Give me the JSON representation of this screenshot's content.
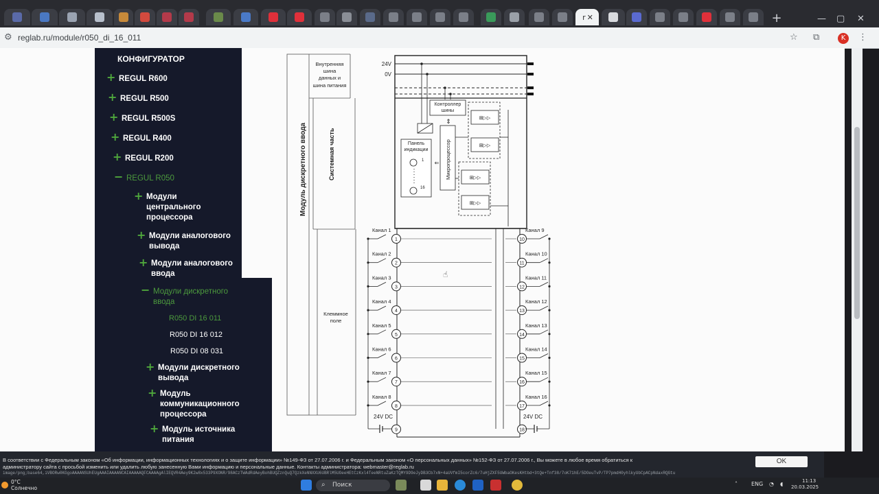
{
  "browser": {
    "active_tab_title": "r",
    "url": "reglab.ru/module/r050_di_16_011",
    "avatar_letter": "K"
  },
  "sidebar": {
    "title": "КОНФИГУРАТОР",
    "items": [
      {
        "label": "REGUL R600"
      },
      {
        "label": "REGUL R500"
      },
      {
        "label": "REGUL R500S"
      },
      {
        "label": "REGUL R400"
      },
      {
        "label": "REGUL R200"
      },
      {
        "label": "REGUL R050",
        "expanded": true
      }
    ],
    "sub_items": [
      {
        "label": "Модули центрального процессора"
      },
      {
        "label": "Модули аналогового вывода"
      },
      {
        "label": "Модули аналогового ввода"
      },
      {
        "label": "Модули дискретного ввода",
        "expanded": true
      },
      {
        "label": "Модули дискретного вывода"
      },
      {
        "label": "Модуль коммуникационного процессора"
      },
      {
        "label": "Модуль источника питания"
      }
    ],
    "modules": [
      {
        "label": "R050 DI 16 011",
        "selected": true
      },
      {
        "label": "R050 DI 16 012"
      },
      {
        "label": "R050 DI 08 031"
      }
    ]
  },
  "diagram": {
    "side_title": "Модуль дискретного ввода",
    "system_part": "Системная часть",
    "internal_bus": [
      "Внутренняя",
      "шина",
      "данных и",
      "шина питания"
    ],
    "terminal_field": [
      "Клеммное",
      "поле"
    ],
    "bus_24v": "24V",
    "bus_0v": "0V",
    "bus_controller": [
      "Контроллер",
      "шины"
    ],
    "indication_panel": [
      "Панель",
      "индикации"
    ],
    "microprocessor": "Микропроцессор",
    "channels_left": [
      "Канал 1",
      "Канал 2",
      "Канал 3",
      "Канал 4",
      "Канал 5",
      "Канал 6",
      "Канал 7",
      "Канал 8"
    ],
    "channels_right": [
      "Канал 9",
      "Канал 10",
      "Канал 11",
      "Канал 12",
      "Канал 13",
      "Канал 14",
      "Канал 15",
      "Канал 16"
    ],
    "terminals_left": [
      "1",
      "2",
      "3",
      "4",
      "5",
      "6",
      "7",
      "8",
      "9"
    ],
    "terminals_right": [
      "10",
      "11",
      "12",
      "13",
      "14",
      "15",
      "16",
      "17",
      "18"
    ],
    "supply_label": "24V DC",
    "led_first": "1",
    "led_last": "16"
  },
  "cookie": {
    "line1": "В соответствии с Федеральным законом «Об информации, информационных технологиях и о защите информации» №149-ФЗ от 27.07.2006 г. и Федеральным законом «О персональных данных» №152-ФЗ от 27.07.2006 г., Вы можете в любое время обратиться к",
    "line2": "администратору сайта с просьбой изменить или удалить любую занесенную Вами информацию и персональные данные. Контакты администратора: webmaster@reglab.ru",
    "line3": "image/png;base64,iVBORw0KGgoAAAANSUhEUgAAAIAAAANCAIAAAAAQFCAAAAgAlIEQVR4Aey9K2w8x533P9XONR/98ACzTWAdRdAeyBohBUQZznQuQ7QzkXeNNXXU6UBRlM5UOeeHEtCzKxl4TeeNRtuZaKzTQMY9D9eJyDB3Cb7xN+4aUVfmI5corZc6/7uHjZXF5UWbaOKesKHtbd+3tQe+Tnf38/7oK71hE/5DOeuTvP/TP7pmdH0yhlkyUbCpACpNdaxRQGtu",
    "ok_button": "OK"
  },
  "taskbar": {
    "weather_temp": "0°C",
    "weather_desc": "Солнечно",
    "search_placeholder": "Поиск",
    "language": "ENG",
    "time": "11:13",
    "date": "20.03.2025"
  }
}
